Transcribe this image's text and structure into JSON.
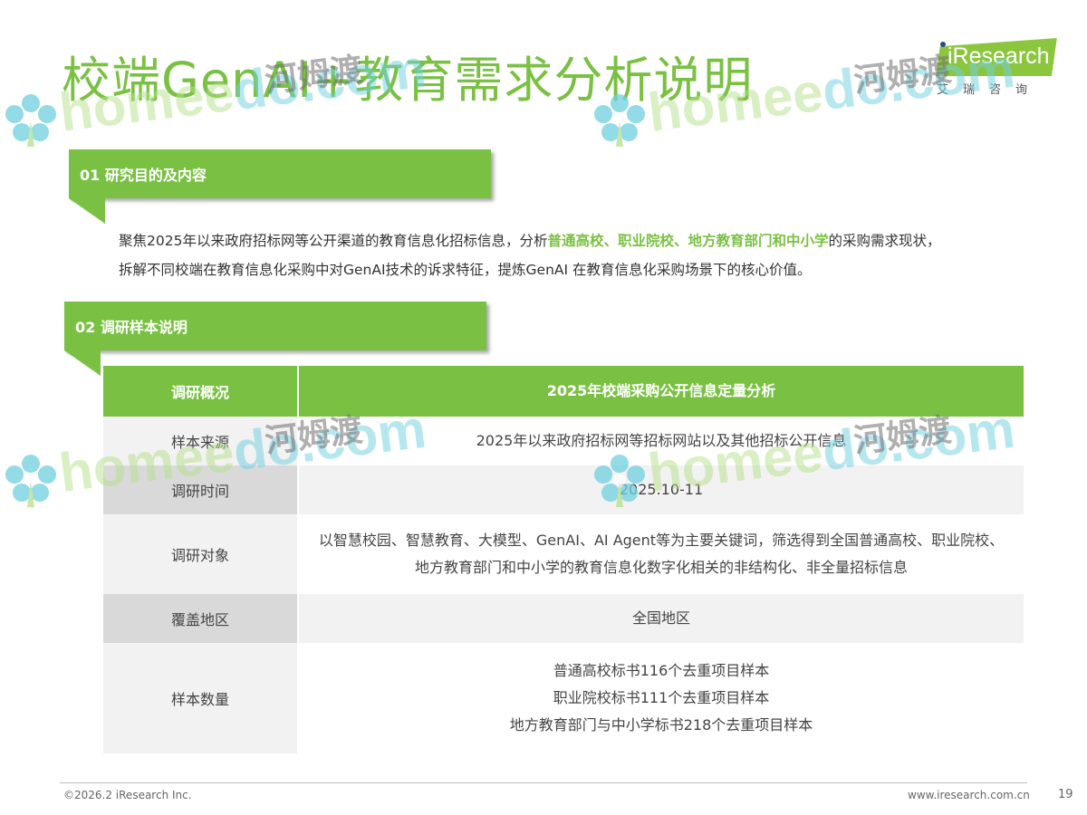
{
  "title": "校端GenAI+教育需求分析说明",
  "logo": {
    "brand": "iResearch",
    "sub": "艾瑞咨询"
  },
  "section1": {
    "label": "01 研究目的及内容",
    "intro_line1_pre": "聚焦2025年以来政府招标网等公开渠道的教育信息化招标信息，分析",
    "intro_line1_hl": "普通高校、职业院校、地方教育部门和中小学",
    "intro_line1_post": "的采购需求现状，",
    "intro_line2": "拆解不同校端在教育信息化采购中对GenAI技术的诉求特征，提炼GenAI 在教育信息化采购场景下的核心价值。"
  },
  "section2": {
    "label": "02 调研样本说明"
  },
  "table": {
    "head": {
      "left": "调研概况",
      "right": "2025年校端采购公开信息定量分析"
    },
    "rows": [
      {
        "label": "样本来源",
        "lines": [
          "2025年以来政府招标网等招标网站以及其他招标公开信息"
        ]
      },
      {
        "label": "调研时间",
        "lines": [
          "2025.10-11"
        ]
      },
      {
        "label": "调研对象",
        "lines": [
          "以智慧校园、智慧教育、大模型、GenAI、AI Agent等为主要关键词，筛选得到全国普通高校、职业院校、",
          "地方教育部门和中小学的教育信息化数字化相关的非结构化、非全量招标信息"
        ]
      },
      {
        "label": "覆盖地区",
        "lines": [
          "全国地区"
        ]
      },
      {
        "label": "样本数量",
        "lines": [
          "普通高校标书116个去重项目样本",
          "职业院校标书111个去重项目样本",
          "地方教育部门与中小学标书218个去重项目样本"
        ]
      }
    ]
  },
  "footer": {
    "copyright": "©2026.2 iResearch Inc.",
    "url": "www.iresearch.com.cn",
    "page": "19"
  },
  "watermark": {
    "text_green": "home",
    "text_cyan": "do.com",
    "text_green_mid": "e",
    "cn": "河姆渡"
  }
}
